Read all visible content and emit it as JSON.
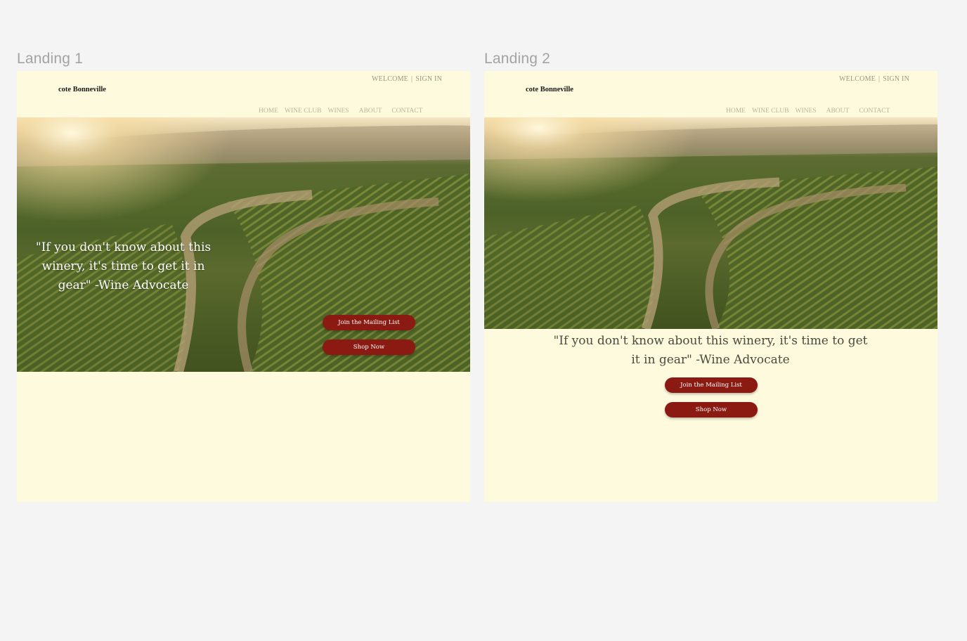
{
  "frames": [
    {
      "label": "Landing 1",
      "header": {
        "welcome": "WELCOME",
        "separator": "|",
        "sign_in": "SIGN IN",
        "logo": "cote Bonneville",
        "nav": [
          "HOME",
          "WINE CLUB",
          "WINES",
          "ABOUT",
          "CONTACT"
        ]
      },
      "hero": {
        "quote": "\"If you don't know about this winery, it's time to get it in gear\" -Wine Advocate"
      },
      "buttons": {
        "join": "Join the Mailing List",
        "shop": "Shop Now"
      }
    },
    {
      "label": "Landing 2",
      "header": {
        "welcome": "WELCOME",
        "separator": "|",
        "sign_in": "SIGN IN",
        "logo": "cote Bonneville",
        "nav": [
          "HOME",
          "WINE CLUB",
          "WINES",
          "ABOUT",
          "CONTACT"
        ]
      },
      "hero": {
        "quote": "\"If you don't know about this winery, it's time to get it in gear\" -Wine Advocate"
      },
      "buttons": {
        "join": "Join the Mailing List",
        "shop": "Shop Now"
      }
    }
  ],
  "colors": {
    "canvas": "#f4f4f4",
    "page_background": "#fdfadd",
    "button": "#8a1a12",
    "frame_label": "#a3a3a3"
  }
}
